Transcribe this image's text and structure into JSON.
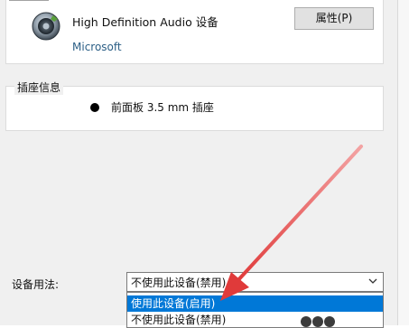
{
  "device": {
    "name": "High Definition Audio 设备",
    "vendor": "Microsoft",
    "properties_button": "属性(P)",
    "icon": "speaker-icon"
  },
  "jack_info": {
    "group_title": "插座信息",
    "jack_label": "前面板 3.5 mm 插座",
    "jack_color": "#000000"
  },
  "device_usage": {
    "label": "设备用法:",
    "selected_value": "不使用此设备(禁用)",
    "options": [
      "使用此设备(启用)",
      "不使用此设备(禁用)"
    ],
    "highlighted_option": "使用此设备(启用)"
  },
  "annotation": {
    "arrow_color": "#e03a3a"
  },
  "colors": {
    "selection_blue": "#0078d7",
    "vendor_link_blue": "#2c5f86",
    "dialog_background": "#f0f0f0"
  }
}
